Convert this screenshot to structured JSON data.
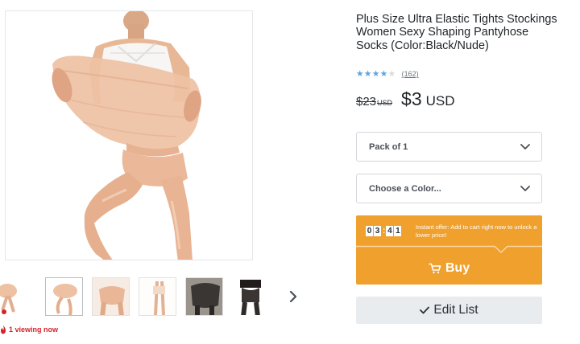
{
  "product": {
    "title": "Plus Size Ultra Elastic Tights Stockings Women Sexy Shaping Pantyhose Socks (Color:Black/Nude)",
    "rating": {
      "stars": 4,
      "max": 5,
      "review_count": "(162)"
    },
    "price": {
      "old": "$23",
      "old_currency": "USD",
      "new": "$3",
      "new_currency": "USD"
    }
  },
  "options": {
    "pack": {
      "label": "Pack of 1",
      "icon": "chevron-down-icon"
    },
    "color": {
      "label": "Choose a Color...",
      "icon": "chevron-down-icon"
    }
  },
  "offer": {
    "timer_digits": [
      "0",
      "3",
      "4",
      "1"
    ],
    "timer_separator": ":",
    "text": "Instant offer: Add to cart right now to unlock a lower price!",
    "buy_label": "Buy",
    "buy_icon": "cart-icon"
  },
  "edit_list": {
    "label": "Edit List",
    "icon": "checkmark"
  },
  "gallery": {
    "thumbnails": [
      "thumbnail-1",
      "thumbnail-2",
      "thumbnail-3",
      "thumbnail-4",
      "thumbnail-5",
      "thumbnail-6"
    ],
    "next_icon": "chevron-right-icon"
  },
  "viewing": {
    "text": "1 viewing now",
    "icon": "flame-icon"
  },
  "colors": {
    "accent_orange": "#f0a02c",
    "star_blue": "#5ba4e0",
    "alert_red": "#d2232a",
    "edit_bg": "#e9ecee",
    "skin": "#e8b394"
  }
}
